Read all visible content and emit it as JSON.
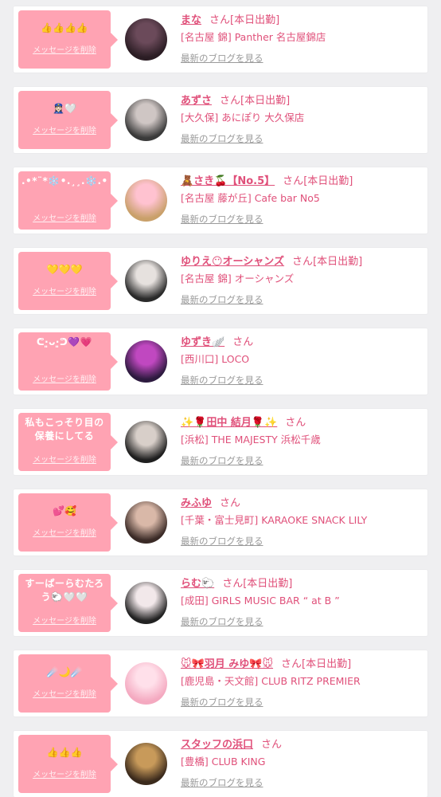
{
  "delete_label": "メッセージを削除",
  "san_label": "さん",
  "blog_label": "最新のブログを見る",
  "colors": {
    "background": "#efeff1",
    "bubble": "#ffa3b3",
    "name": "#e0507a",
    "link_gray": "#9a9a9a"
  },
  "items": [
    {
      "message": "👍👍👍👍",
      "name": "まな",
      "status": "[本日出勤]",
      "shop": "[名古屋 錦] Panther 名古屋錦店",
      "avatar_colors": [
        "#2b1d24",
        "#6b4a5a"
      ]
    },
    {
      "message": "👮🏻‍♀️🤍",
      "name": "あずさ",
      "status": "[本日出勤]",
      "shop": "[大久保] あにぽり 大久保店",
      "avatar_colors": [
        "#3a3a3a",
        "#cfc6c4"
      ]
    },
    {
      "message": ".•*¨*❄️•.¸¸.❄️.•*¨*❄️",
      "name": "🧸さき🍒【No.5】",
      "status": "[本日出勤]",
      "shop": "[名古屋 藤が丘] Cafe bar No5",
      "avatar_colors": [
        "#c9a06a",
        "#ffc2d0"
      ]
    },
    {
      "message": "💛💛💛",
      "name": "ゆりえ😶オーシャンズ",
      "status": "[本日出勤]",
      "shop": "[名古屋 錦] オーシャンズ",
      "avatar_colors": [
        "#2a2a2a",
        "#e6e1de"
      ]
    },
    {
      "message": "ᕦ·͈ᴗ·͈ᕤ💜💗",
      "name": "ゆずき🪽",
      "status": "",
      "shop": "[西川口] LOCO",
      "avatar_colors": [
        "#2d1a3f",
        "#c048c0"
      ]
    },
    {
      "message": "私もこっそり目の保養にしてる",
      "name": "✨🌹田中 結月🌹✨",
      "status": "",
      "shop": "[浜松] THE MAJESTY 浜松千歳",
      "avatar_colors": [
        "#1f1f1f",
        "#d8cfc9"
      ]
    },
    {
      "message": "💕🥰",
      "name": "みふゆ",
      "status": "",
      "shop": "[千葉・富士見町] KARAOKE SNACK LILY",
      "avatar_colors": [
        "#3a2a26",
        "#d9b8a8"
      ]
    },
    {
      "message": "すーぱーらむたろう🐑🤍🤍",
      "name": "らむ🐑",
      "status": "[本日出勤]",
      "shop": "[成田] GIRLS MUSIC BAR “ at B ”",
      "avatar_colors": [
        "#222222",
        "#f2e8ea"
      ]
    },
    {
      "message": "☄️🌙☄️",
      "name": "🐭🎀羽月 みゆ🎀🐭",
      "status": "[本日出勤]",
      "shop": "[鹿児島・天文館] CLUB RITZ PREMIER",
      "avatar_colors": [
        "#f4a9c0",
        "#ffe0ea"
      ]
    },
    {
      "message": "👍👍👍",
      "name": "スタッフの浜口",
      "status": "",
      "shop": "[豊橋] CLUB KING",
      "avatar_colors": [
        "#3b2a1c",
        "#c89a5a"
      ]
    }
  ]
}
